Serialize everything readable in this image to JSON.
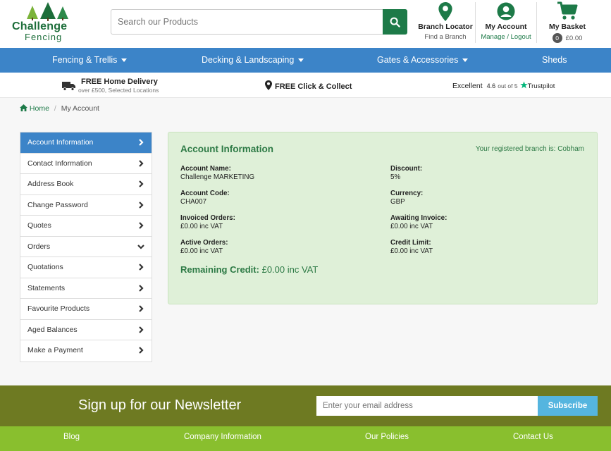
{
  "brand": {
    "line1": "Challenge",
    "line2": "Fencing"
  },
  "search": {
    "placeholder": "Search our Products"
  },
  "header": {
    "branch": {
      "label": "Branch Locator",
      "sub": "Find a Branch"
    },
    "account": {
      "label": "My Account",
      "sub": "Manage / Logout"
    },
    "basket": {
      "label": "My Basket",
      "count": "0",
      "total": "£0.00"
    }
  },
  "nav": {
    "items": [
      {
        "label": "Fencing & Trellis"
      },
      {
        "label": "Decking & Landscaping"
      },
      {
        "label": "Gates & Accessories"
      },
      {
        "label": "Sheds"
      }
    ]
  },
  "usp": {
    "delivery_title": "FREE Home Delivery",
    "delivery_sub": "over £500, Selected Locations",
    "collect": "FREE Click & Collect",
    "trust_word": "Excellent",
    "trust_score": "4.6",
    "trust_outof": "out of 5",
    "trust_brand": "Trustpilot"
  },
  "breadcrumb": {
    "home": "Home",
    "sep": "/",
    "current": "My Account"
  },
  "sidebar": {
    "items": [
      {
        "label": "Account Information",
        "active": true
      },
      {
        "label": "Contact Information"
      },
      {
        "label": "Address Book"
      },
      {
        "label": "Change Password"
      },
      {
        "label": "Quotes"
      },
      {
        "label": "Orders",
        "expanded": true
      },
      {
        "label": "Quotations"
      },
      {
        "label": "Statements"
      },
      {
        "label": "Favourite Products"
      },
      {
        "label": "Aged Balances"
      },
      {
        "label": "Make a Payment"
      }
    ]
  },
  "account": {
    "title": "Account Information",
    "branch_text": "Your registered branch is: Cobham",
    "fields": [
      {
        "label": "Account Name:",
        "value": "Challenge MARKETING"
      },
      {
        "label": "Discount:",
        "value": "5%"
      },
      {
        "label": "Account Code:",
        "value": "CHA007"
      },
      {
        "label": "Currency:",
        "value": "GBP"
      },
      {
        "label": "Invoiced Orders:",
        "value": "£0.00 inc VAT"
      },
      {
        "label": "Awaiting Invoice:",
        "value": "£0.00 inc VAT"
      },
      {
        "label": "Active Orders:",
        "value": "£0.00 inc VAT"
      },
      {
        "label": "Credit Limit:",
        "value": "£0.00 inc VAT"
      }
    ],
    "remaining_label": "Remaining Credit:",
    "remaining_value": "£0.00 inc VAT"
  },
  "newsletter": {
    "title": "Sign up for our Newsletter",
    "placeholder": "Enter your email address",
    "button": "Subscribe"
  },
  "footer": {
    "items": [
      {
        "label": "Blog"
      },
      {
        "label": "Company Information"
      },
      {
        "label": "Our Policies"
      },
      {
        "label": "Contact Us"
      }
    ]
  },
  "colors": {
    "brand_green": "#1d7a48",
    "nav_blue": "#3c84c8",
    "panel_bg": "#dff0d8",
    "newsletter_bg": "#6e7a22",
    "footer_bg": "#89bf2e",
    "subscribe_bg": "#55b5df"
  }
}
